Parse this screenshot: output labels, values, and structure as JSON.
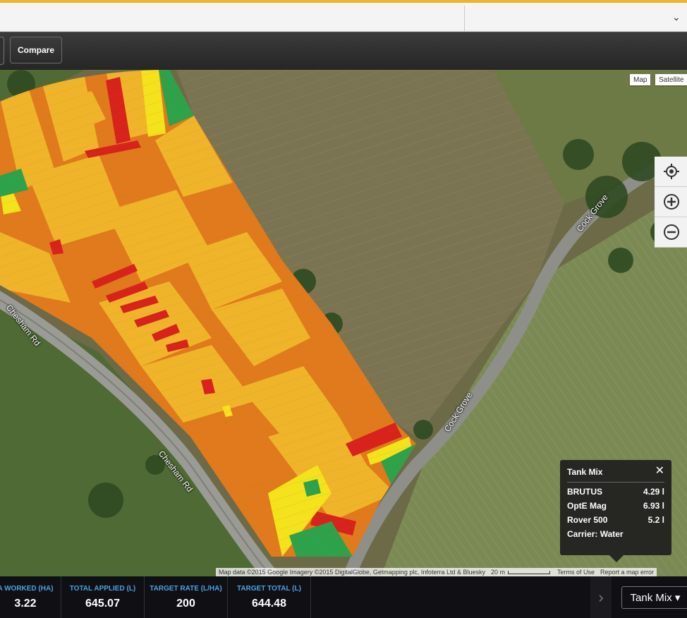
{
  "toolbar": {
    "compare_label": "Compare"
  },
  "map": {
    "type_map": "Map",
    "type_satellite": "Satellite",
    "road_labels": [
      "Chesham Rd",
      "Chesham Rd",
      "Cock Grove",
      "Cock Grove"
    ],
    "controls": {
      "locate_icon": "crosshair-icon",
      "zoom_in_icon": "plus-icon",
      "zoom_out_icon": "minus-icon"
    },
    "attribution": "Map data ©2015 Google Imagery ©2015 DigitalGlobe, Getmapping plc, Infoterra Ltd & Bluesky",
    "scale": "20 m",
    "terms": "Terms of Use",
    "report": "Report a map error"
  },
  "popup": {
    "title": "Tank Mix",
    "close_icon": "close-icon",
    "rows": [
      {
        "name": "BRUTUS",
        "value": "4.29 l"
      },
      {
        "name": "OptE Mag",
        "value": "6.93 l"
      },
      {
        "name": "Rover 500",
        "value": "5.2 l"
      }
    ],
    "carrier": "Carrier: Water"
  },
  "stats": [
    {
      "label": "A WORKED (HA)",
      "value": "3.22"
    },
    {
      "label": "TOTAL APPLIED (L)",
      "value": "645.07"
    },
    {
      "label": "TARGET RATE (L/HA)",
      "value": "200"
    },
    {
      "label": "TARGET TOTAL (L)",
      "value": "644.48"
    }
  ],
  "bottom": {
    "nav_arrow": "›",
    "dropdown_label": "Tank Mix ▾"
  },
  "colors": {
    "accent": "#f0b32a",
    "stat_label": "#4aa3df",
    "high": "#d8221c",
    "mid": "#e07a1c",
    "low": "#f0b42a",
    "lowest": "#2da24a"
  }
}
